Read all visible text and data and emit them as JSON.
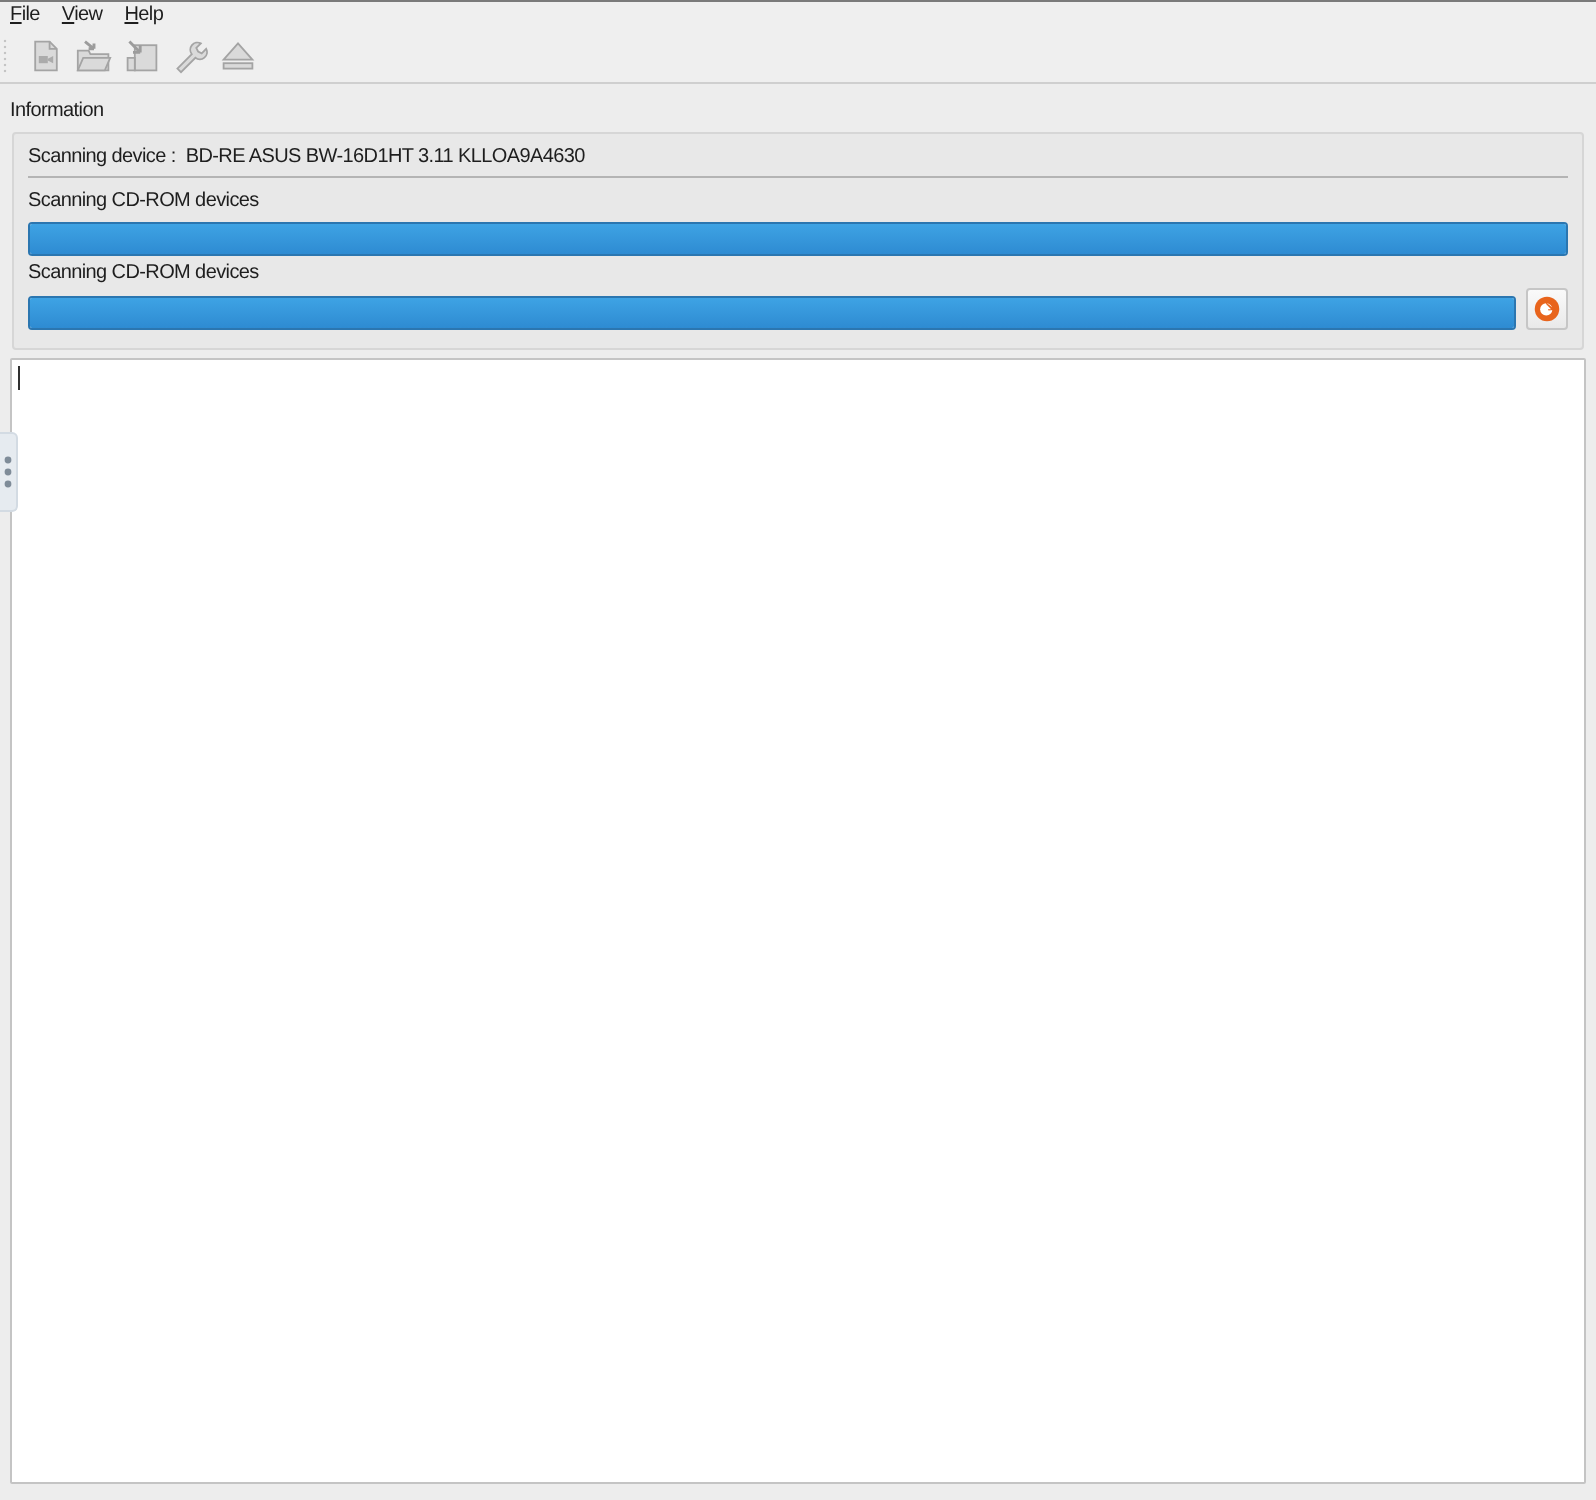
{
  "menu": [
    {
      "label": "File"
    },
    {
      "label": "View"
    },
    {
      "label": "Help"
    }
  ],
  "toolbar": [
    {
      "kind": "new",
      "disabled": true
    },
    {
      "kind": "open",
      "disabled": true
    },
    {
      "kind": "import",
      "disabled": true
    },
    {
      "kind": "settings",
      "disabled": true
    },
    {
      "kind": "eject",
      "disabled": true
    }
  ],
  "information": {
    "title": "Information",
    "device_label": "Scanning device :",
    "device_value": "BD-RE ASUS BW-16D1HT 3.11 KLLOA9A4630",
    "progress": [
      {
        "label": "Scanning CD-ROM devices",
        "level": 1,
        "action_button": false
      },
      {
        "label": "Scanning CD-ROM devices",
        "level": 1,
        "action_button": true
      }
    ]
  },
  "log": {
    "focused": true
  }
}
